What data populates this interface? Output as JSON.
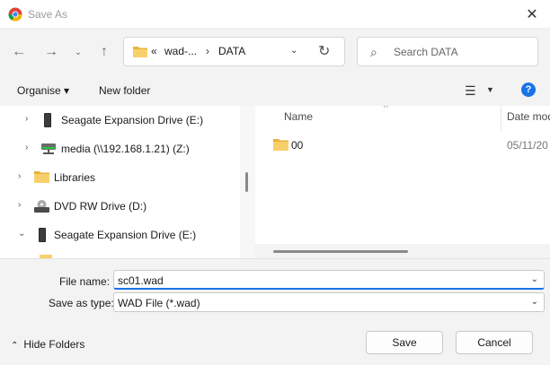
{
  "window": {
    "title": "Save As"
  },
  "address": {
    "overflow": "«",
    "segments": [
      "wad-...",
      "DATA"
    ],
    "separator": "›"
  },
  "search": {
    "placeholder": "Search DATA"
  },
  "toolbar": {
    "organise": "Organise ▾",
    "new_folder": "New folder",
    "help": "?"
  },
  "tree": [
    {
      "label": "Seagate Expansion Drive (E:)",
      "expander": "›",
      "icon": "drive-icon"
    },
    {
      "label": "media (\\\\192.168.1.21) (Z:)",
      "expander": "›",
      "icon": "network-drive-icon"
    },
    {
      "label": "Libraries",
      "expander": "›",
      "icon": "libraries-icon"
    },
    {
      "label": "DVD RW Drive (D:)",
      "expander": "›",
      "icon": "dvd-drive-icon"
    },
    {
      "label": "Seagate Expansion Drive (E:)",
      "expander": "⌄",
      "icon": "drive-icon"
    }
  ],
  "file_list": {
    "columns": [
      "Name",
      "Date mod"
    ],
    "rows": [
      {
        "name": "00",
        "date": "05/11/20"
      }
    ]
  },
  "form": {
    "file_name_label": "File name:",
    "file_name_value": "sc01.wad",
    "save_type_label": "Save as type:",
    "save_type_value": "WAD File (*.wad)"
  },
  "footer": {
    "hide_folders": "Hide Folders",
    "save": "Save",
    "cancel": "Cancel"
  }
}
